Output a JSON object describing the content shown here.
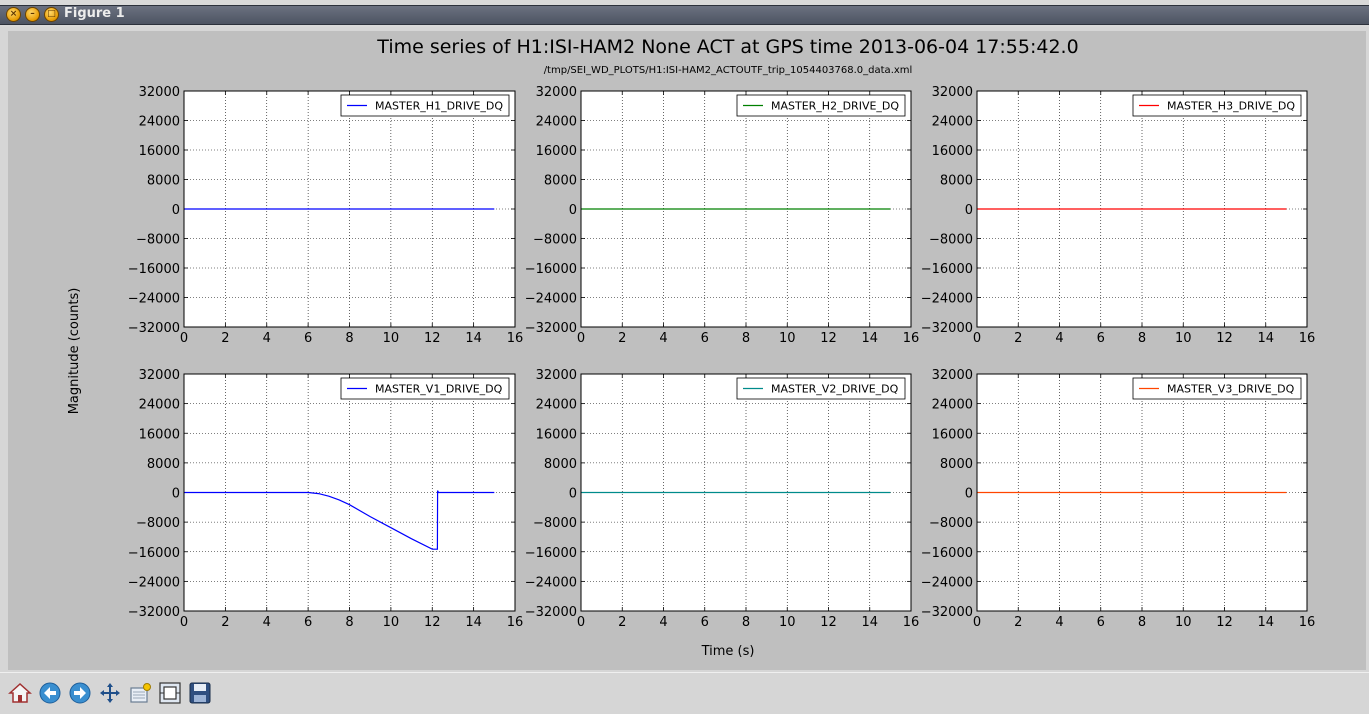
{
  "window": {
    "title": "Figure 1"
  },
  "figure": {
    "title": "Time series of H1:ISI-HAM2 None ACT at GPS time 2013-06-04 17:55:42.0",
    "subtitle": "/tmp/SEI_WD_PLOTS/H1:ISI-HAM2_ACTOUTF_trip_1054403768.0_data.xml",
    "ylabel": "Magnitude (counts)",
    "xlabel": "Time (s)"
  },
  "toolbar": {
    "buttons": [
      {
        "name": "home",
        "icon": "home-icon"
      },
      {
        "name": "back",
        "icon": "arrow-left-icon"
      },
      {
        "name": "forward",
        "icon": "arrow-right-icon"
      },
      {
        "name": "pan",
        "icon": "move-icon"
      },
      {
        "name": "zoom",
        "icon": "zoom-rect-icon"
      },
      {
        "name": "subplots",
        "icon": "subplots-icon"
      },
      {
        "name": "save",
        "icon": "save-icon"
      }
    ]
  },
  "chart_data": [
    {
      "type": "line",
      "legend_loc": "upper right",
      "grid": true,
      "xlim": [
        0,
        16
      ],
      "ylim": [
        -32000,
        32000
      ],
      "xticks": [
        0,
        2,
        4,
        6,
        8,
        10,
        12,
        14,
        16
      ],
      "yticks": [
        32000,
        24000,
        16000,
        8000,
        0,
        -8000,
        -16000,
        -24000,
        -32000
      ],
      "series": [
        {
          "name": "MASTER_H1_DRIVE_DQ",
          "color": "#0000ff",
          "x": [
            0,
            15
          ],
          "y": [
            0,
            0
          ]
        }
      ]
    },
    {
      "type": "line",
      "legend_loc": "upper right",
      "grid": true,
      "xlim": [
        0,
        16
      ],
      "ylim": [
        -32000,
        32000
      ],
      "xticks": [
        0,
        2,
        4,
        6,
        8,
        10,
        12,
        14,
        16
      ],
      "yticks": [
        32000,
        24000,
        16000,
        8000,
        0,
        -8000,
        -16000,
        -24000,
        -32000
      ],
      "series": [
        {
          "name": "MASTER_H2_DRIVE_DQ",
          "color": "#008000",
          "x": [
            0,
            15
          ],
          "y": [
            0,
            0
          ]
        }
      ]
    },
    {
      "type": "line",
      "legend_loc": "upper right",
      "grid": true,
      "xlim": [
        0,
        16
      ],
      "ylim": [
        -32000,
        32000
      ],
      "xticks": [
        0,
        2,
        4,
        6,
        8,
        10,
        12,
        14,
        16
      ],
      "yticks": [
        32000,
        24000,
        16000,
        8000,
        0,
        -8000,
        -16000,
        -24000,
        -32000
      ],
      "series": [
        {
          "name": "MASTER_H3_DRIVE_DQ",
          "color": "#ff0000",
          "x": [
            0,
            15
          ],
          "y": [
            0,
            0
          ]
        }
      ]
    },
    {
      "type": "line",
      "legend_loc": "upper right",
      "grid": true,
      "xlim": [
        0,
        16
      ],
      "ylim": [
        -32000,
        32000
      ],
      "xticks": [
        0,
        2,
        4,
        6,
        8,
        10,
        12,
        14,
        16
      ],
      "yticks": [
        32000,
        24000,
        16000,
        8000,
        0,
        -8000,
        -16000,
        -24000,
        -32000
      ],
      "series": [
        {
          "name": "MASTER_V1_DRIVE_DQ",
          "color": "#0000ff",
          "x": [
            0,
            6.0,
            6.5,
            7.0,
            7.5,
            8.0,
            9.0,
            10.0,
            11.0,
            12.0,
            12.25,
            12.26,
            12.3,
            15
          ],
          "y": [
            0,
            0,
            -300,
            -1000,
            -2000,
            -3300,
            -6500,
            -9500,
            -12500,
            -15300,
            -15300,
            500,
            0,
            0
          ]
        }
      ]
    },
    {
      "type": "line",
      "legend_loc": "upper right",
      "grid": true,
      "xlim": [
        0,
        16
      ],
      "ylim": [
        -32000,
        32000
      ],
      "xticks": [
        0,
        2,
        4,
        6,
        8,
        10,
        12,
        14,
        16
      ],
      "yticks": [
        32000,
        24000,
        16000,
        8000,
        0,
        -8000,
        -16000,
        -24000,
        -32000
      ],
      "series": [
        {
          "name": "MASTER_V2_DRIVE_DQ",
          "color": "#008b8b",
          "x": [
            0,
            15
          ],
          "y": [
            0,
            0
          ]
        }
      ]
    },
    {
      "type": "line",
      "legend_loc": "upper right",
      "grid": true,
      "xlim": [
        0,
        16
      ],
      "ylim": [
        -32000,
        32000
      ],
      "xticks": [
        0,
        2,
        4,
        6,
        8,
        10,
        12,
        14,
        16
      ],
      "yticks": [
        32000,
        24000,
        16000,
        8000,
        0,
        -8000,
        -16000,
        -24000,
        -32000
      ],
      "series": [
        {
          "name": "MASTER_V3_DRIVE_DQ",
          "color": "#ff4500",
          "x": [
            0,
            15
          ],
          "y": [
            0,
            0
          ]
        }
      ]
    }
  ]
}
